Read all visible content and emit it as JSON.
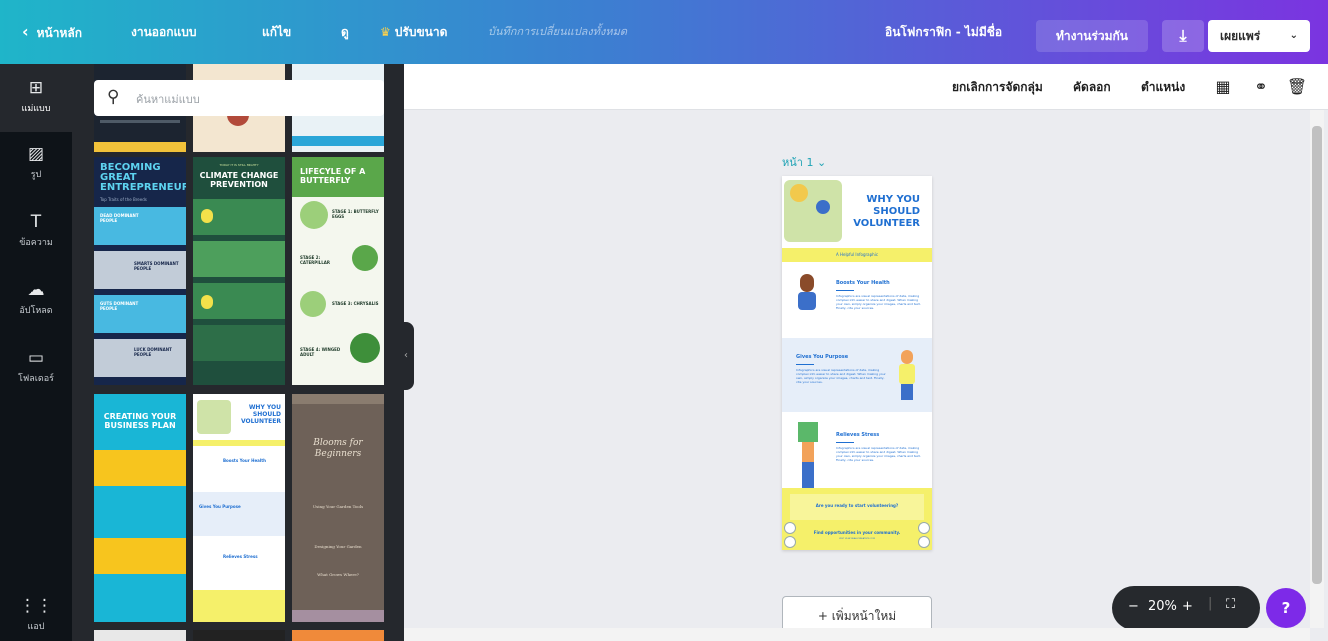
{
  "topbar": {
    "back_label": "หน้าหลัก",
    "menu": [
      "งานออกแบบ",
      "แก้ไข",
      "ดู",
      "ปรับขนาด"
    ],
    "save_status": "บันทึกการเปลี่ยนแปลงทั้งหมด",
    "doc_title": "อินโฟกราฟิก - ไม่มีชื่อ",
    "collaborate_label": "ทำงานร่วมกัน",
    "publish_label": "เผยแพร่"
  },
  "rail": {
    "items": [
      {
        "label": "แม่แบบ",
        "icon": "template-icon"
      },
      {
        "label": "รูป",
        "icon": "photo-icon"
      },
      {
        "label": "ข้อความ",
        "icon": "text-icon"
      },
      {
        "label": "อัปโหลด",
        "icon": "upload-icon"
      },
      {
        "label": "โฟลเดอร์",
        "icon": "folder-icon"
      },
      {
        "label": "แอป",
        "icon": "apps-icon"
      }
    ]
  },
  "search": {
    "placeholder": "ค้นหาแม่แบบ"
  },
  "templates": {
    "t1": {
      "title": "BECOMING GREAT ENTREPRENEURS",
      "sub": "Top Traits of the Breeds",
      "rows": [
        "DEAD DOMINANT PEOPLE",
        "SMARTS DOMINANT PEOPLE",
        "GUTS DOMINANT PEOPLE",
        "LUCK DOMINANT PEOPLE"
      ]
    },
    "t2": {
      "kicker": "TODAY IT IS STILL MIGHTY",
      "title": "CLIMATE CHANGE PREVENTION"
    },
    "t3": {
      "title": "LIFECYLE OF A BUTTERFLY",
      "stages": [
        "STAGE 1: BUTTERFLY EGGS",
        "STAGE 2: CATERPILLAR",
        "STAGE 3: CHRYSALIS",
        "STAGE 4: WINGED ADULT"
      ]
    },
    "t4": {
      "title": "CREATING YOUR BUSINESS PLAN"
    },
    "t5": {
      "title": "WHY YOU SHOULD VOLUNTEER",
      "rows": [
        "Boosts Your Health",
        "Gives You Purpose",
        "Relieves Stress"
      ]
    },
    "t6": {
      "title": "Blooms for Beginners",
      "rows": [
        "Using Your Garden Tools",
        "Designing Your Garden",
        "What Grows Where?"
      ]
    }
  },
  "actionbar": {
    "ungroup": "ยกเลิกการจัดกลุ่ม",
    "copy": "คัดลอก",
    "position": "ตำแหน่ง"
  },
  "canvas": {
    "page_label": "หน้า 1",
    "title": "WHY YOU SHOULD VOLUNTEER",
    "subtitle": "A Helpful Infographic",
    "sections": [
      {
        "heading": "Boosts Your Health",
        "body": "Infographics are visual representations of data, making complex info easier to share and digest. When making your own, simply organize your images, charts and text. Finally, cite your sources."
      },
      {
        "heading": "Gives You Purpose",
        "body": "Infographics are visual representations of data, making complex info easier to share and digest. When making your own, simply organize your images, charts and text. Finally, cite your sources."
      },
      {
        "heading": "Relieves Stress",
        "body": "Infographics are visual representations of data, making complex info easier to share and digest. When making your own, simply organize your images, charts and text. Finally, cite your sources."
      }
    ],
    "cta": "Are you ready to start volunteering?",
    "footer": "Find opportunities in your community.",
    "footer_url": "VISIT US AT REALLYGREATSITE.COM"
  },
  "add_page_label": "+ เพิ่มหน้าใหม่",
  "zoom": {
    "level": "20%",
    "minus": "−",
    "plus": "+"
  },
  "help_label": "?",
  "colors": {
    "accent": "#7d2ae8",
    "topbar_start": "#1fb5c9",
    "topbar_end": "#7b34e0",
    "volunteer_blue": "#1f6fd1",
    "volunteer_yellow": "#f5f06a"
  }
}
